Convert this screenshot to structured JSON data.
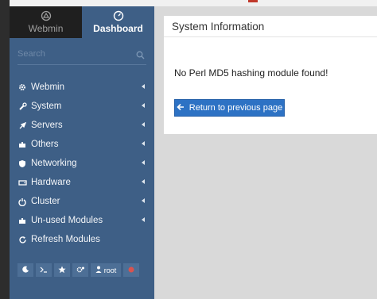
{
  "sidebar": {
    "tabs": [
      {
        "label": "Webmin",
        "icon": "webmin-logo-icon"
      },
      {
        "label": "Dashboard",
        "icon": "dashboard-gauge-icon"
      }
    ],
    "search": {
      "placeholder": "Search",
      "icon": "search-icon"
    },
    "items": [
      {
        "label": "Webmin",
        "icon": "gear-icon",
        "has_submenu": true
      },
      {
        "label": "System",
        "icon": "wrench-icon",
        "has_submenu": true
      },
      {
        "label": "Servers",
        "icon": "rocket-icon",
        "has_submenu": true
      },
      {
        "label": "Others",
        "icon": "puzzle-icon",
        "has_submenu": true
      },
      {
        "label": "Networking",
        "icon": "shield-icon",
        "has_submenu": true
      },
      {
        "label": "Hardware",
        "icon": "hdd-icon",
        "has_submenu": true
      },
      {
        "label": "Cluster",
        "icon": "power-icon",
        "has_submenu": true
      },
      {
        "label": "Un-used Modules",
        "icon": "puzzle-icon",
        "has_submenu": true
      },
      {
        "label": "Refresh Modules",
        "icon": "refresh-icon",
        "has_submenu": false
      }
    ],
    "bottom_bar": {
      "night_mode_icon": "moon-icon",
      "terminal_icon": "terminal-icon",
      "favorites_icon": "star-icon",
      "settings_icon": "cogs-icon",
      "user": "root",
      "user_icon": "user-icon",
      "logout_icon": "logout-icon"
    }
  },
  "panel": {
    "title": "System Information",
    "message": "No Perl MD5 hashing module found!",
    "button_label": "Return to previous page",
    "button_icon": "arrow-left-icon"
  },
  "colors": {
    "sidebar_bg": "#3e5f86",
    "webmin_tab_bg": "#1f1f1f",
    "button_blue": "#2d72c4",
    "logout_red": "#d9534f"
  }
}
